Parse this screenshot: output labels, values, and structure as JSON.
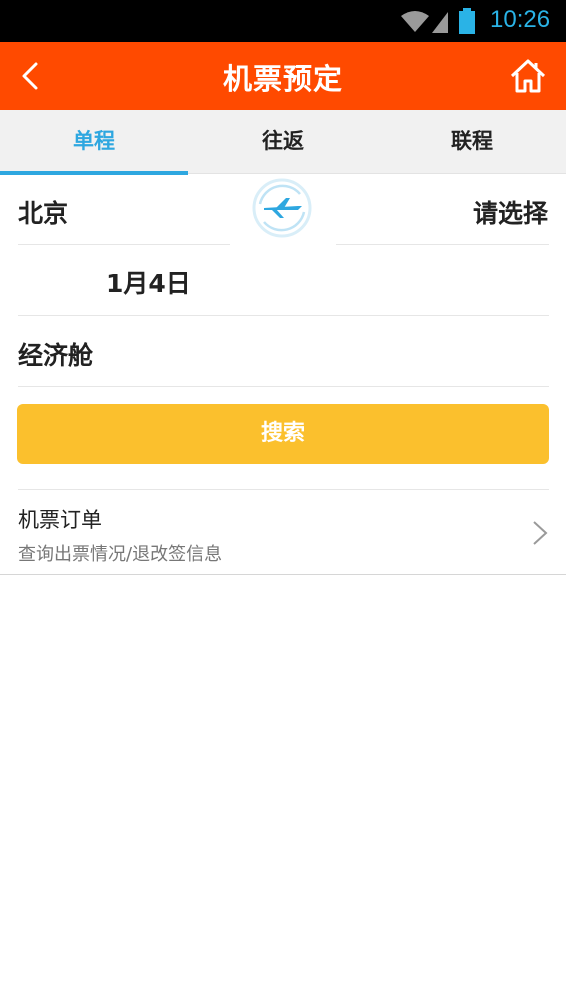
{
  "status_bar": {
    "time": "10:26"
  },
  "header": {
    "title": "机票预定"
  },
  "tabs": [
    {
      "label": "单程",
      "active": true
    },
    {
      "label": "往返",
      "active": false
    },
    {
      "label": "联程",
      "active": false
    }
  ],
  "form": {
    "from_city": "北京",
    "to_city": "请选择",
    "date": "1月4日",
    "cabin": "经济舱",
    "search_label": "搜索"
  },
  "orders": {
    "title": "机票订单",
    "subtitle": "查询出票情况/退改签信息"
  },
  "colors": {
    "header_bg": "#ff4a00",
    "accent": "#2ea7e0",
    "search_button": "#fbc02d"
  },
  "icons": {
    "back": "chevron-left-icon",
    "home": "home-icon",
    "swap": "airplane-swap-icon",
    "orders_arrow": "chevron-right-icon"
  }
}
